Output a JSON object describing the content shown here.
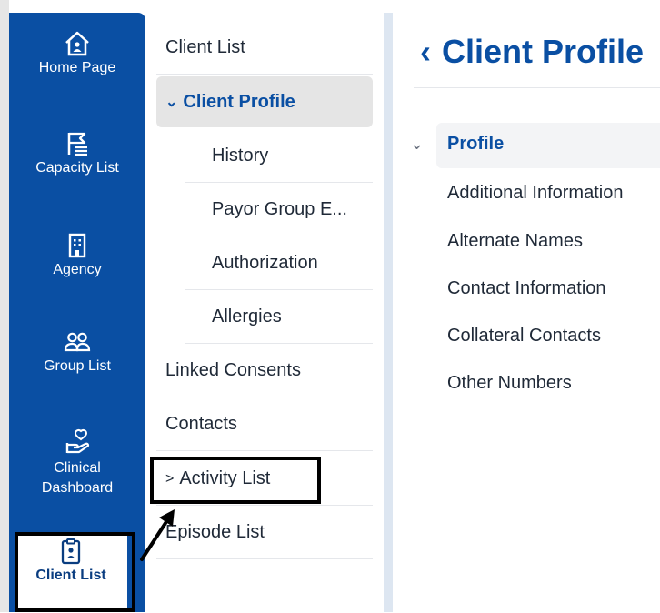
{
  "rail": {
    "items": [
      {
        "label": "Home Page",
        "icon": "home-icon"
      },
      {
        "label": "Capacity List",
        "icon": "capacity-list-icon"
      },
      {
        "label": "Agency",
        "icon": "building-icon"
      },
      {
        "label": "Group List",
        "icon": "group-icon"
      },
      {
        "label": "Clinical Dashboard",
        "label_line1": "Clinical",
        "label_line2": "Dashboard",
        "icon": "hand-heart-icon"
      },
      {
        "label": "Client List",
        "icon": "clipboard-person-icon"
      }
    ]
  },
  "subnav": {
    "items": [
      {
        "label": "Client List"
      },
      {
        "label": "Client Profile",
        "chevron": "⌄"
      },
      {
        "label": "History"
      },
      {
        "label": "Payor Group E..."
      },
      {
        "label": "Authorization"
      },
      {
        "label": "Allergies"
      },
      {
        "label": "Linked Consents"
      },
      {
        "label": "Contacts"
      },
      {
        "label": "Activity List",
        "chevron": ">"
      },
      {
        "label": "Episode List"
      }
    ]
  },
  "main": {
    "back_glyph": "‹",
    "title": "Client Profile",
    "section": {
      "label": "Profile",
      "caret": "⌄"
    },
    "section_items": [
      "Additional Information",
      "Alternate Names",
      "Contact Information",
      "Collateral Contacts",
      "Other Numbers"
    ]
  },
  "colors": {
    "accent": "#0a4fa3",
    "highlight": "#000000"
  }
}
